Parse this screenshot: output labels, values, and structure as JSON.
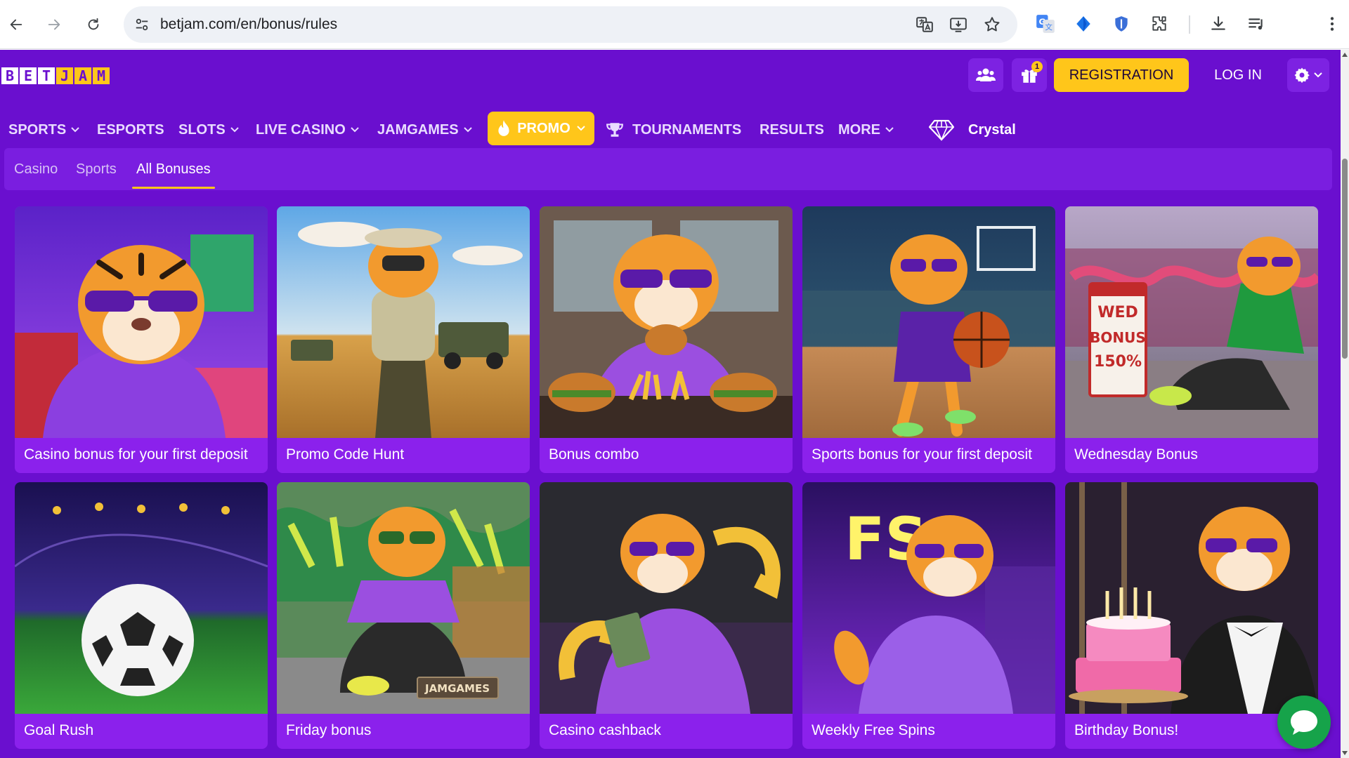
{
  "browser": {
    "url": "betjam.com/en/bonus/rules"
  },
  "site": {
    "logo_letters": [
      "B",
      "E",
      "T",
      "J",
      "A",
      "M"
    ],
    "header": {
      "gift_badge_count": "1",
      "registration_label": "REGISTRATION",
      "login_label": "LOG IN"
    },
    "nav": {
      "sports": "SPORTS",
      "esports": "ESPORTS",
      "slots": "SLOTS",
      "live_casino": "LIVE CASINO",
      "jamgames": "JAMGAMES",
      "promo": "PROMO",
      "tournaments": "TOURNAMENTS",
      "results": "RESULTS",
      "more": "MORE",
      "crystal": "Crystal"
    },
    "subnav": {
      "casino": "Casino",
      "sports": "Sports",
      "all_bonuses": "All Bonuses"
    },
    "cards": [
      {
        "title": "Casino bonus for your first deposit"
      },
      {
        "title": "Promo Code Hunt"
      },
      {
        "title": "Bonus combo"
      },
      {
        "title": "Sports bonus for your first deposit"
      },
      {
        "title": "Wednesday Bonus",
        "sign": [
          "WED",
          "BONUS",
          "150%"
        ]
      },
      {
        "title": "Goal Rush"
      },
      {
        "title": "Friday bonus",
        "sign": "JAMGAMES"
      },
      {
        "title": "Casino cashback"
      },
      {
        "title": "Weekly Free Spins",
        "neon": "FS"
      },
      {
        "title": "Birthday Bonus!"
      }
    ]
  },
  "colors": {
    "brand_purple": "#6a0fcf",
    "accent_yellow": "#ffc61a",
    "card_purple": "#8b21ec",
    "chat_green": "#16a34a"
  }
}
